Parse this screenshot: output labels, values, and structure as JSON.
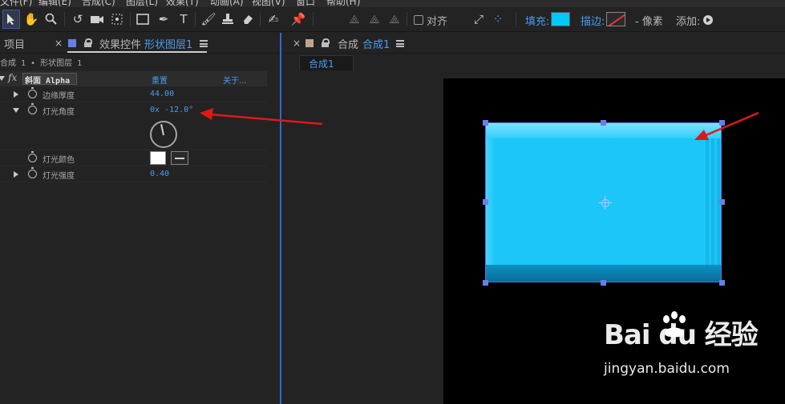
{
  "menubar": {
    "items": [
      "文件(F)",
      "编辑(E)",
      "合成(C)",
      "图层(L)",
      "效果(T)",
      "动画(A)",
      "视图(V)",
      "窗口",
      "帮助(H)"
    ]
  },
  "toolbar": {
    "snap_label": "对齐",
    "fill_label": "填充:",
    "stroke_label": "描边:",
    "px_label": "- 像素",
    "add_label": "添加:",
    "fill_color": "#00c8f8"
  },
  "left_panel": {
    "project_tab": "项目",
    "effects_tab_prefix": "效果控件",
    "effects_tab_layer": "形状图层1",
    "breadcrumb": "合成 1 • 形状图层 1",
    "effect": {
      "fx_label": "fx",
      "name": "斜面 Alpha",
      "reset_label": "重置",
      "about_label": "关于..."
    },
    "properties": [
      {
        "label": "边缘厚度",
        "value": "44.00"
      },
      {
        "label": "灯光角度",
        "value": "0x -12.0°"
      },
      {
        "label": "灯光颜色",
        "value": ""
      },
      {
        "label": "灯光强度",
        "value": "0.40"
      }
    ],
    "light_color": "#ffffff"
  },
  "right_panel": {
    "comp_tab_label": "合成",
    "comp_tab_name": "合成1",
    "subtab": "合成1",
    "shape_color": "#1cc6f8"
  },
  "watermark": {
    "logo_text": "Bai du 经验",
    "url": "jingyan.baidu.com"
  },
  "annotation_color": "#e01818"
}
